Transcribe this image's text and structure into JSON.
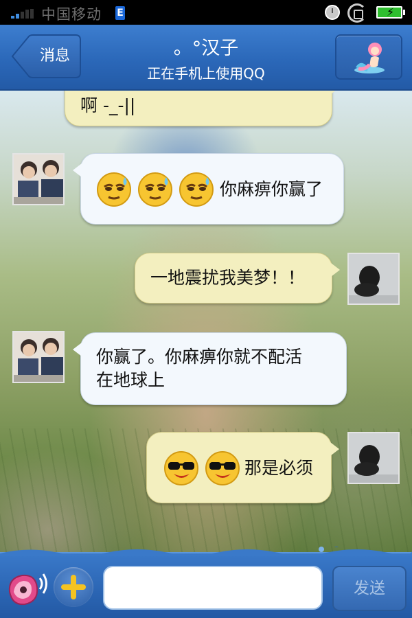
{
  "status_bar": {
    "carrier": "中国移动",
    "network_type": "E"
  },
  "header": {
    "back_label": "消息",
    "contact_name": "。°汉子",
    "contact_status": "正在手机上使用QQ",
    "accent_color": "#2b68b9"
  },
  "messages": [
    {
      "side": "right",
      "sender": "me",
      "emoji_count": 0,
      "text": "啊 -_-||"
    },
    {
      "side": "left",
      "sender": "friend",
      "emoji": "sweat-smile-emoji",
      "emoji_count": 3,
      "text": "你麻痹你赢了"
    },
    {
      "side": "right",
      "sender": "me",
      "emoji_count": 0,
      "text": "一地震扰我美梦！！"
    },
    {
      "side": "left",
      "sender": "friend",
      "emoji_count": 0,
      "text_lines": [
        "你赢了。你麻痹你就不配活",
        "在地球上"
      ]
    },
    {
      "side": "right",
      "sender": "me",
      "emoji": "cool-sunglasses-emoji",
      "emoji_count": 2,
      "text": "那是必须"
    }
  ],
  "input_bar": {
    "placeholder": "",
    "send_label": "发送"
  }
}
